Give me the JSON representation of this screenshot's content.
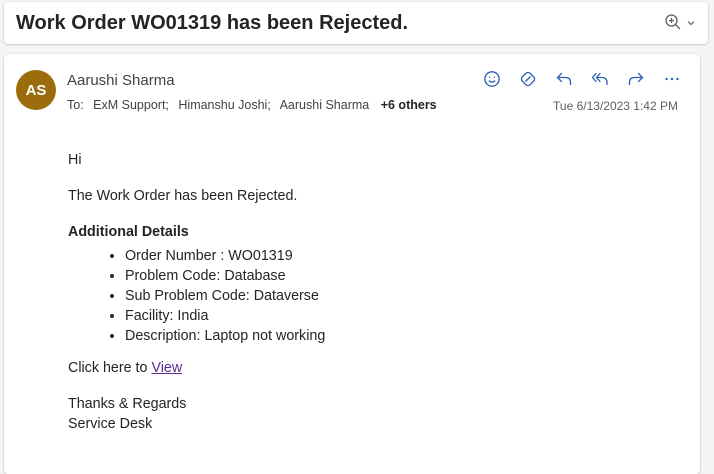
{
  "subject": "Work Order WO01319 has been Rejected.",
  "zoom": {
    "icon": "zoom-in-icon",
    "chevron": "chevron-down-icon"
  },
  "sender": {
    "initials": "AS",
    "name": "Aarushi Sharma",
    "avatar_color": "#9a6c0c"
  },
  "recipients": {
    "prefix": "To:",
    "names": [
      "ExM Support;",
      "Himanshu Joshi;",
      "Aarushi Sharma"
    ],
    "more": "+6 others"
  },
  "timestamp": "Tue 6/13/2023 1:42 PM",
  "actions": [
    {
      "name": "emoji-react-icon"
    },
    {
      "name": "loop-icon"
    },
    {
      "name": "reply-icon"
    },
    {
      "name": "reply-all-icon"
    },
    {
      "name": "forward-icon"
    },
    {
      "name": "more-options-icon"
    }
  ],
  "body": {
    "greeting": "Hi",
    "intro": "The Work Order has been Rejected.",
    "details_heading": "Additional Details",
    "details": [
      "Order Number : WO01319",
      "Problem Code: Database",
      "Sub Problem Code: Dataverse",
      "Facility: India",
      "Description: Laptop not working"
    ],
    "click_prefix": "Click here to ",
    "link_text": "View",
    "signoff": [
      "Thanks & Regards",
      "Service Desk"
    ]
  },
  "colors": {
    "accent": "#2b5fb4",
    "link": "#5c2d91",
    "avatar": "#9a6c0c"
  }
}
